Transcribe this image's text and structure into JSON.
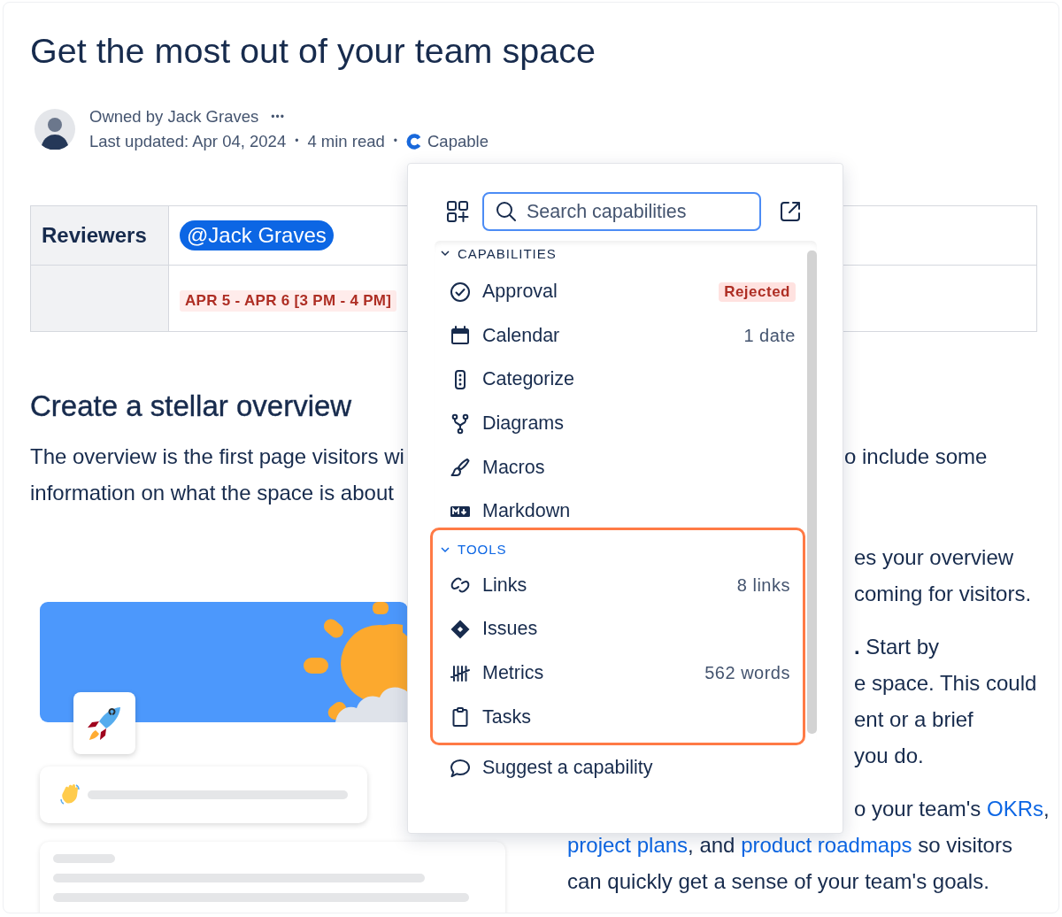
{
  "page": {
    "title": "Get the most out of your team space",
    "byline": {
      "owner": "Owned by Jack Graves",
      "more": "•••",
      "updated": "Last updated: Apr 04, 2024",
      "separator_1": "•",
      "read_time": "4 min read",
      "separator_2": "•",
      "app": "Capable"
    }
  },
  "table": {
    "rows": [
      {
        "header": "Reviewers",
        "cell": {
          "kind": "mention",
          "text": "@Jack Graves"
        }
      },
      {
        "cell": {
          "kind": "date",
          "text": "APR 5 - APR 6 [3 PM - 4 PM]"
        }
      }
    ]
  },
  "section": {
    "heading": "Create a stellar overview",
    "lines": [
      {
        "left": "The overview is the first page visitors wi",
        "right": "o include some"
      },
      {
        "left": "information on what the space is about"
      }
    ],
    "paragraphs": [
      {
        "lines": [
          {
            "partly_hidden": true,
            "parts": [
              {
                "text": "es your overview"
              }
            ]
          },
          {
            "partly_hidden": true,
            "parts": [
              {
                "text": "coming for visitors."
              }
            ]
          }
        ]
      },
      {
        "lines": [
          {
            "partly_hidden": true,
            "parts": [
              {
                "text": "**.** Start by"
              }
            ]
          },
          {
            "partly_hidden": true,
            "parts": [
              {
                "text": "e space. This could"
              }
            ]
          },
          {
            "partly_hidden": true,
            "parts": [
              {
                "text": "ent or a brief"
              }
            ]
          },
          {
            "partly_hidden": true,
            "parts": [
              {
                "text": "you do."
              }
            ]
          }
        ]
      },
      {
        "lines": [
          {
            "partly_hidden": true,
            "parts": [
              {
                "text": "o your team's "
              },
              {
                "text": "OKRs",
                "link": true
              },
              {
                "text": ","
              }
            ]
          },
          {
            "partly_hidden": false,
            "parts": [
              {
                "text": "project plans",
                "link": true
              },
              {
                "text": ", and "
              },
              {
                "text": "product roadmaps",
                "link": true
              },
              {
                "text": " so visitors"
              }
            ]
          },
          {
            "partly_hidden": false,
            "parts": [
              {
                "text": "can quickly get a sense of your team's goals."
              }
            ]
          }
        ]
      }
    ]
  },
  "popup": {
    "search": {
      "placeholder": "Search capabilities"
    },
    "groups": [
      {
        "title": "CAPABILITIES",
        "expanded": true,
        "selected": false,
        "items": [
          {
            "label": "Approval",
            "meta": {
              "kind": "lozenge",
              "text": "Rejected"
            }
          },
          {
            "label": "Calendar",
            "meta": {
              "kind": "count",
              "text": "1 date"
            }
          },
          {
            "label": "Categorize"
          },
          {
            "label": "Diagrams"
          },
          {
            "label": "Macros"
          },
          {
            "label": "Markdown"
          }
        ]
      },
      {
        "title": "TOOLS",
        "expanded": true,
        "selected": true,
        "items": [
          {
            "label": "Links",
            "meta": {
              "kind": "count",
              "text": "8 links"
            }
          },
          {
            "label": "Issues"
          },
          {
            "label": "Metrics",
            "meta": {
              "kind": "count",
              "text": "562 words"
            }
          },
          {
            "label": "Tasks"
          }
        ]
      }
    ],
    "suggest": "Suggest a capability"
  }
}
